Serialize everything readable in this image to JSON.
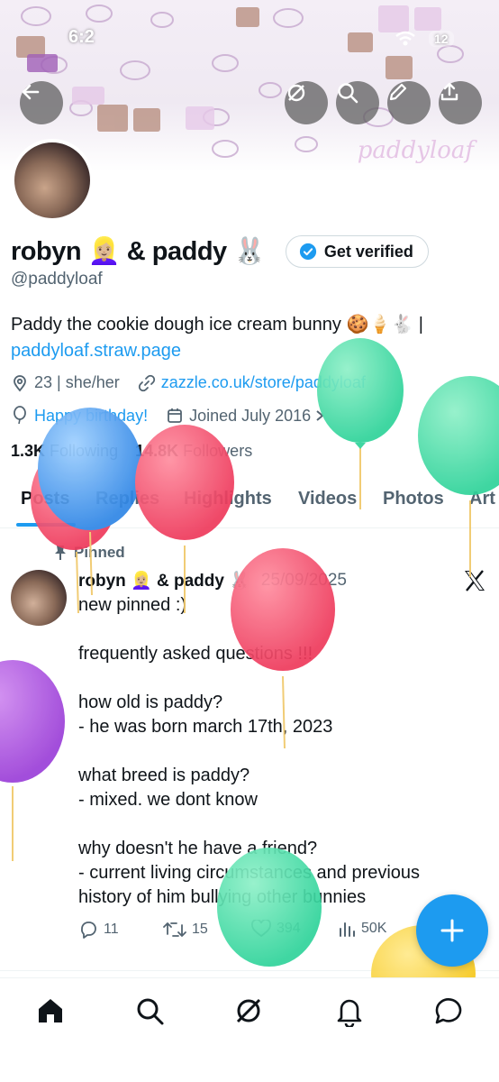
{
  "status_bar": {
    "time": "6:2",
    "battery": "12"
  },
  "header_buttons": [
    "back-icon",
    "grok-icon",
    "search-icon",
    "edit-icon",
    "share-icon"
  ],
  "banner": {
    "signature": "paddyloaf"
  },
  "profile": {
    "name": "robyn 👱🏼‍♀️ & paddy 🐰",
    "handle": "@paddyloaf",
    "verify_label": "Get verified",
    "bio_text": "Paddy the cookie dough ice cream bunny 🍪🍦🐇 |",
    "bio_link": "paddyloaf.straw.page",
    "location": "23 | she/her",
    "website": "zazzle.co.uk/store/paddyloaf",
    "birthday": "Happy birthday!",
    "joined": "Joined July 2016",
    "following_count": "1.3K",
    "following_label": "Following",
    "followers_count": "14.8K",
    "followers_label": "Followers"
  },
  "tabs": [
    "Posts",
    "Replies",
    "Highlights",
    "Videos",
    "Photos",
    "Art"
  ],
  "tweet": {
    "pinned_label": "Pinned",
    "author": "robyn 👱🏼‍♀️ & paddy 🐰",
    "date": "25/09/2025",
    "lines": [
      "new pinned :)",
      "",
      "frequently asked questions !!!",
      "",
      "how old is paddy?",
      "- he was born march 17th, 2023",
      "",
      "what breed is paddy?",
      "- mixed. we dont know",
      "",
      "why doesn't he have a friend?",
      "- current living circumstances and previous",
      "history of him bullying other bunnies"
    ],
    "replies": "11",
    "reposts": "15",
    "likes": "394",
    "views": "50K"
  },
  "colors": {
    "accent": "#1d9bf0",
    "text": "#0f1419",
    "muted": "#536471"
  }
}
